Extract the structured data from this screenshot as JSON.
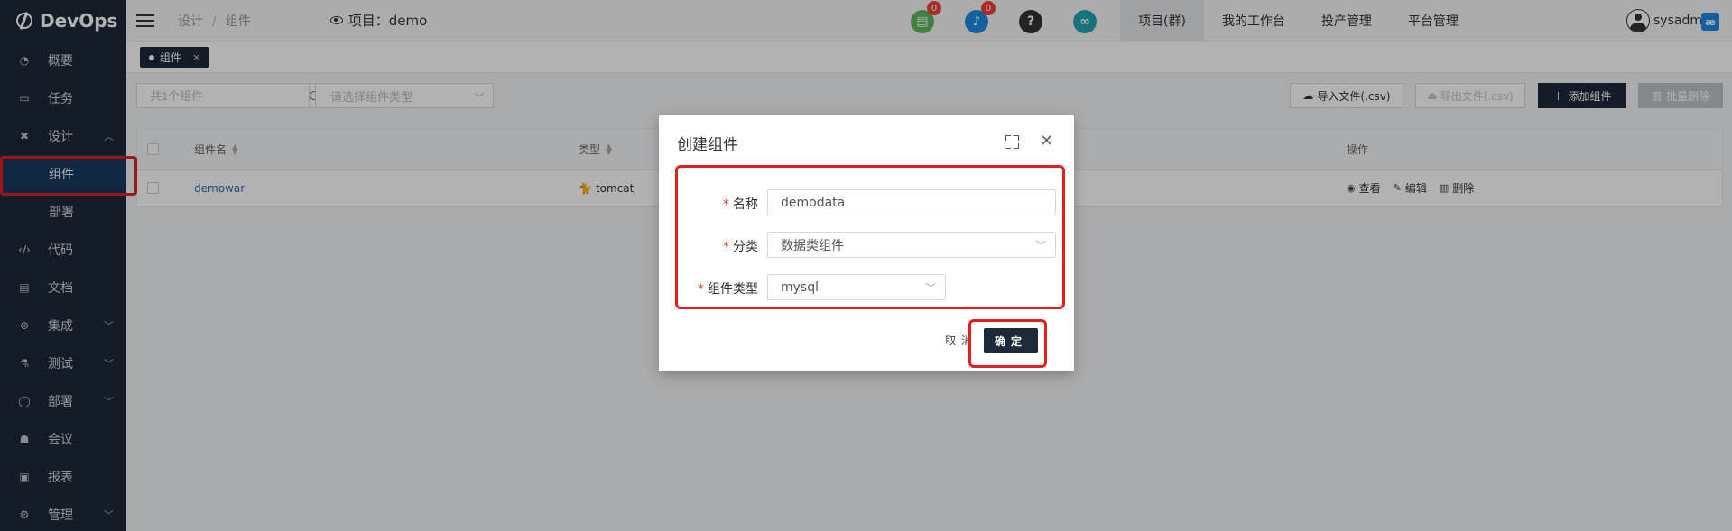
{
  "app": {
    "name": "DevOps"
  },
  "sidebar": {
    "items": [
      {
        "label": "概要",
        "icon": "dashboard-icon"
      },
      {
        "label": "任务",
        "icon": "folder-icon"
      },
      {
        "label": "设计",
        "icon": "tools-icon",
        "expanded": true
      },
      {
        "label": "代码",
        "icon": "code-icon"
      },
      {
        "label": "文档",
        "icon": "document-icon"
      },
      {
        "label": "集成",
        "icon": "integration-icon"
      },
      {
        "label": "测试",
        "icon": "flask-icon"
      },
      {
        "label": "部署",
        "icon": "deploy-icon"
      },
      {
        "label": "会议",
        "icon": "meeting-icon"
      },
      {
        "label": "报表",
        "icon": "report-icon"
      },
      {
        "label": "管理",
        "icon": "gear-icon"
      }
    ],
    "sub_items": [
      {
        "label": "组件",
        "active": true
      },
      {
        "label": "部署"
      }
    ]
  },
  "header": {
    "breadcrumb": [
      "设计",
      "组件"
    ],
    "project_label": "项目：demo",
    "badges": {
      "doc": "0",
      "bell": "0"
    },
    "help_glyph": "?",
    "nav": [
      "项目(群)",
      "我的工作台",
      "投产管理",
      "平台管理"
    ],
    "user": "sysadm",
    "ae_label": "æ"
  },
  "tabs": [
    {
      "label": "组件",
      "close": "×"
    }
  ],
  "toolbar": {
    "search_placeholder": "共1个组件",
    "type_placeholder": "请选择组件类型",
    "import_label": "导入文件(.csv)",
    "export_label": "导出文件(.csv)",
    "add_label": "添加组件",
    "batch_delete_label": "批量删除"
  },
  "table": {
    "headers": {
      "name": "组件名",
      "type": "类型",
      "actions": "操作"
    },
    "rows": [
      {
        "name": "demowar",
        "type": "tomcat",
        "view": "查看",
        "edit": "编辑",
        "delete": "删除"
      }
    ]
  },
  "modal": {
    "title": "创建组件",
    "fields": [
      {
        "label": "名称",
        "value": "demodata",
        "required": true
      },
      {
        "label": "分类",
        "value": "数据类组件",
        "required": true
      },
      {
        "label": "组件类型",
        "value": "mysql",
        "required": true
      }
    ],
    "required_mark": "*",
    "cancel_label": "取消",
    "ok_label": "确定"
  },
  "colors": {
    "sidebar_bg": "#1e2a38",
    "active_bg": "#18385e",
    "highlight": "#e02020",
    "doc_icon": "#5cb85c",
    "bell_icon": "#1e88e5",
    "help_icon": "#333333",
    "link_icon": "#1fa4b7"
  }
}
